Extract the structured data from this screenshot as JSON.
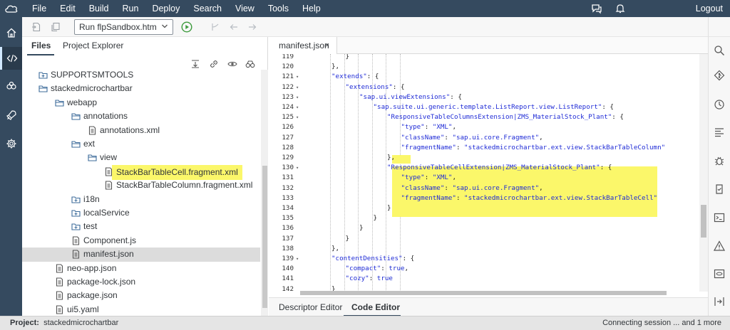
{
  "menubar": {
    "items": [
      "File",
      "Edit",
      "Build",
      "Run",
      "Deploy",
      "Search",
      "View",
      "Tools",
      "Help"
    ],
    "logout": "Logout",
    "icons": [
      "sap-cloud-logo-icon",
      "chat-icon",
      "bell-icon"
    ]
  },
  "activity": {
    "icons": [
      "home-icon",
      "code-icon",
      "puzzle-icon",
      "rocket-icon",
      "gear-icon"
    ],
    "active_index": 1
  },
  "toolbar": {
    "run_config": "Run flpSandbox.htm",
    "icons": [
      "new-file-icon",
      "copy-icon",
      "run-icon",
      "branch-icon",
      "arrow-left-icon",
      "arrow-right-icon"
    ]
  },
  "files_panel": {
    "tabs": [
      "Files",
      "Project Explorer"
    ],
    "active_tab": 0,
    "tree": [
      {
        "label": "SUPPORTSMTOOLS",
        "indent": 1,
        "type": "folder"
      },
      {
        "label": "stackedmicrochartbar",
        "indent": 1,
        "type": "folder-open"
      },
      {
        "label": "webapp",
        "indent": 2,
        "type": "folder-open"
      },
      {
        "label": "annotations",
        "indent": 3,
        "type": "folder-open"
      },
      {
        "label": "annotations.xml",
        "indent": 4,
        "type": "file"
      },
      {
        "label": "ext",
        "indent": 3,
        "type": "folder-open"
      },
      {
        "label": "view",
        "indent": 4,
        "type": "folder-open"
      },
      {
        "label": "StackBarTableCell.fragment.xml",
        "indent": 5,
        "type": "file",
        "highlight": true
      },
      {
        "label": "StackBarTableColumn.fragment.xml",
        "indent": 5,
        "type": "file"
      },
      {
        "label": "i18n",
        "indent": 3,
        "type": "folder"
      },
      {
        "label": "localService",
        "indent": 3,
        "type": "folder"
      },
      {
        "label": "test",
        "indent": 3,
        "type": "folder"
      },
      {
        "label": "Component.js",
        "indent": 3,
        "type": "file"
      },
      {
        "label": "manifest.json",
        "indent": 3,
        "type": "file",
        "selected": true
      },
      {
        "label": "neo-app.json",
        "indent": 2,
        "type": "file"
      },
      {
        "label": "package-lock.json",
        "indent": 2,
        "type": "file"
      },
      {
        "label": "package.json",
        "indent": 2,
        "type": "file"
      },
      {
        "label": "ui5.yaml",
        "indent": 2,
        "type": "file"
      }
    ]
  },
  "editor": {
    "tab_label": "manifest.json",
    "tab_close": "×",
    "bottom_tabs": [
      "Descriptor Editor",
      "Code Editor"
    ],
    "active_bottom_tab": 1,
    "lines": [
      {
        "n": "119",
        "indent": 3,
        "fold": false,
        "text": "}"
      },
      {
        "n": "120",
        "indent": 2,
        "fold": false,
        "text": "},"
      },
      {
        "n": "121",
        "indent": 2,
        "fold": true,
        "text": "\"extends\": {"
      },
      {
        "n": "122",
        "indent": 3,
        "fold": true,
        "text": "\"extensions\": {"
      },
      {
        "n": "123",
        "indent": 4,
        "fold": true,
        "text": "\"sap.ui.viewExtensions\": {"
      },
      {
        "n": "124",
        "indent": 5,
        "fold": true,
        "text": "\"sap.suite.ui.generic.template.ListReport.view.ListReport\": {"
      },
      {
        "n": "125",
        "indent": 6,
        "fold": true,
        "text": "\"ResponsiveTableColumnsExtension|ZMS_MaterialStock_Plant\": {"
      },
      {
        "n": "126",
        "indent": 7,
        "fold": false,
        "text": "\"type\": \"XML\","
      },
      {
        "n": "127",
        "indent": 7,
        "fold": false,
        "text": "\"className\": \"sap.ui.core.Fragment\","
      },
      {
        "n": "128",
        "indent": 7,
        "fold": false,
        "text": "\"fragmentName\": \"stackedmicrochartbar.ext.view.StackBarTableColumn\""
      },
      {
        "n": "129",
        "indent": 6,
        "fold": false,
        "text": "},"
      },
      {
        "n": "130",
        "indent": 6,
        "fold": true,
        "text": "\"ResponsiveTableCellExtension|ZMS_MaterialStock_Plant\": {"
      },
      {
        "n": "131",
        "indent": 7,
        "fold": false,
        "text": "\"type\": \"XML\","
      },
      {
        "n": "132",
        "indent": 7,
        "fold": false,
        "text": "\"className\": \"sap.ui.core.Fragment\","
      },
      {
        "n": "133",
        "indent": 7,
        "fold": false,
        "text": "\"fragmentName\": \"stackedmicrochartbar.ext.view.StackBarTableCell\""
      },
      {
        "n": "134",
        "indent": 6,
        "fold": false,
        "text": "}"
      },
      {
        "n": "135",
        "indent": 5,
        "fold": false,
        "text": "}"
      },
      {
        "n": "136",
        "indent": 4,
        "fold": false,
        "text": "}"
      },
      {
        "n": "137",
        "indent": 3,
        "fold": false,
        "text": "}"
      },
      {
        "n": "138",
        "indent": 2,
        "fold": false,
        "text": "},"
      },
      {
        "n": "139",
        "indent": 2,
        "fold": true,
        "text": "\"contentDensities\": {"
      },
      {
        "n": "140",
        "indent": 3,
        "fold": false,
        "text": "\"compact\": true,"
      },
      {
        "n": "141",
        "indent": 3,
        "fold": false,
        "text": "\"cozy\": true"
      },
      {
        "n": "142",
        "indent": 2,
        "fold": false,
        "text": "}"
      }
    ]
  },
  "rightbar": {
    "icons": [
      "search-icon",
      "git-icon",
      "history-icon",
      "outline-icon",
      "debug-icon",
      "test-icon",
      "console-icon",
      "warning-icon",
      "preview-icon",
      "deploy-icon"
    ]
  },
  "statusbar": {
    "project_label": "Project:",
    "project_name": "stackedmicrochartbar",
    "status": "Connecting session ... and 1 more"
  },
  "colors": {
    "shell": "#354a5f",
    "highlight": "#fbf76a",
    "selection": "#dcdcdc",
    "code_string": "#1f2bd6"
  }
}
